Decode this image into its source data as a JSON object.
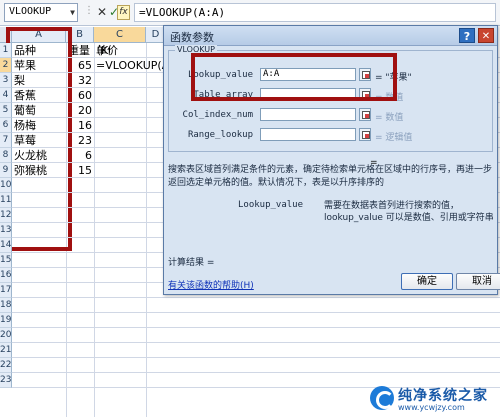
{
  "formula_bar": {
    "namebox": "VLOOKUP",
    "cancel_icon": "cancel-x-icon",
    "enter_icon": "enter-check-icon",
    "fx_label": "fx",
    "formula": "=VLOOKUP(A:A)"
  },
  "sheet": {
    "columns": [
      "A",
      "B",
      "C",
      "D"
    ],
    "rows": [
      "1",
      "2",
      "3",
      "4",
      "5",
      "6",
      "7",
      "8",
      "9",
      "10",
      "11",
      "12",
      "13",
      "14",
      "15",
      "16",
      "17",
      "18",
      "19",
      "20",
      "21",
      "22",
      "23"
    ],
    "cells": {
      "A1": "品种",
      "B1": "重量（KG）",
      "C1": "单价",
      "A2": "苹果",
      "B2": "65",
      "C2": "=VLOOKUP(A:A)",
      "A3": "梨",
      "B3": "32",
      "A4": "香蕉",
      "B4": "60",
      "A5": "葡萄",
      "B5": "20",
      "A6": "杨梅",
      "B6": "16",
      "A7": "草莓",
      "B7": "23",
      "A8": "火龙桃",
      "B8": "6",
      "A9": "弥猴桃",
      "B9": "15"
    }
  },
  "dialog": {
    "title": "函数参数",
    "help_label": "?",
    "close_label": "✕",
    "group_label": "VLOOKUP",
    "args": [
      {
        "name": "Lookup_value",
        "value": "A:A",
        "result": "= \"苹果\""
      },
      {
        "name": "Table_array",
        "value": "",
        "result": "= 数值"
      },
      {
        "name": "Col_index_num",
        "value": "",
        "result": "= 数值"
      },
      {
        "name": "Range_lookup",
        "value": "",
        "result": "= 逻辑值"
      }
    ],
    "equals": "=",
    "description": "搜索表区域首列满足条件的元素，确定待检索单元格在区域中的行序号，再进一步返回选定单元格的值。默认情况下，表是以升序排序的",
    "arg_desc_name": "Lookup_value",
    "arg_desc": "需要在数据表首列进行搜索的值，lookup_value 可以是数值、引用或字符串",
    "result_label": "计算结果 =",
    "help_link": "有关该函数的帮助(H)",
    "ok_label": "确定",
    "cancel_label": "取消"
  },
  "watermark": {
    "title": "纯净系统之家",
    "url": "www.ycwjzy.com"
  }
}
